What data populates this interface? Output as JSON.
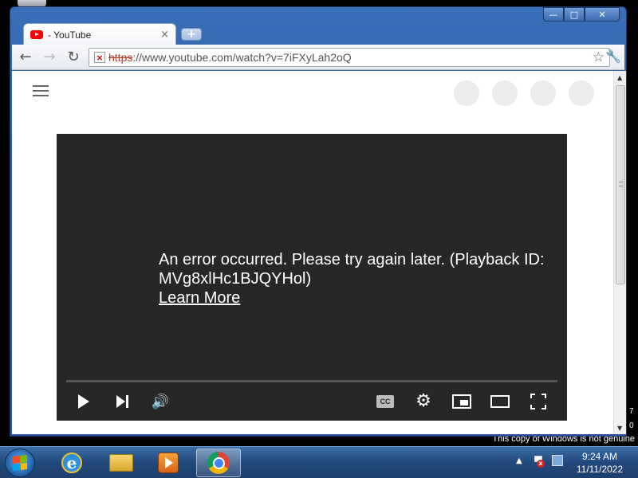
{
  "desktop": {
    "watermark": "This copy of Windows is not genuine",
    "edge_digit_1": "7",
    "edge_digit_2": "0"
  },
  "window": {
    "controls": {
      "minimize": "—",
      "maximize": "□",
      "close": "✕"
    }
  },
  "tab": {
    "title": "- YouTube",
    "close": "×",
    "new_tab": "+"
  },
  "toolbar": {
    "back": "←",
    "forward": "→",
    "reload": "↻",
    "url_scheme": "https",
    "url_rest": "://www.youtube.com/watch?v=7iFXyLah2oQ",
    "star": "☆",
    "wrench": "🔧"
  },
  "page": {
    "error_line1": "An error occurred. Please try again later. (Playback ID:",
    "error_line2": "MVg8xlHc1BJQYHol)",
    "learn_more": "Learn More",
    "cc_label": "CC"
  },
  "taskbar": {
    "apps": [
      "internet-explorer",
      "windows-explorer",
      "windows-media-player",
      "google-chrome"
    ],
    "active_app": "google-chrome",
    "clock_time": "9:24 AM",
    "clock_date": "11/11/2022"
  },
  "colors": {
    "youtube_red": "#ff0000",
    "player_bg": "#272727",
    "taskbar": "#22497b"
  }
}
